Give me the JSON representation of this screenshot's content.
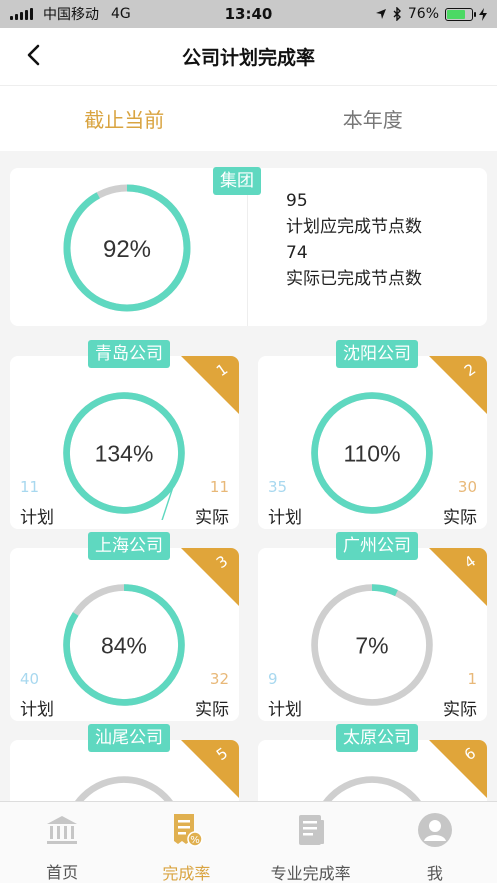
{
  "status_bar": {
    "carrier": "中国移动",
    "network": "4G",
    "time": "13:40",
    "battery": "76%",
    "battery_level": 0.76
  },
  "header": {
    "title": "公司计划完成率",
    "back_icon": "chevron-left-icon"
  },
  "segments": [
    {
      "label": "截止当前",
      "active": true
    },
    {
      "label": "本年度",
      "active": false
    }
  ],
  "group": {
    "tag": "集团",
    "percent": 92,
    "percent_label": "92%",
    "plan_value": "95",
    "plan_label": "计划应完成节点数",
    "actual_value": "74",
    "actual_label": "实际已完成节点数"
  },
  "companies": [
    {
      "name": "青岛公司",
      "rank": "1",
      "percent": 134,
      "percent_label": "134%",
      "plan": "11",
      "actual": "11",
      "plan_label": "计划",
      "actual_label": "实际"
    },
    {
      "name": "沈阳公司",
      "rank": "2",
      "percent": 110,
      "percent_label": "110%",
      "plan": "35",
      "actual": "30",
      "plan_label": "计划",
      "actual_label": "实际"
    },
    {
      "name": "上海公司",
      "rank": "3",
      "percent": 84,
      "percent_label": "84%",
      "plan": "40",
      "actual": "32",
      "plan_label": "计划",
      "actual_label": "实际"
    },
    {
      "name": "广州公司",
      "rank": "4",
      "percent": 7,
      "percent_label": "7%",
      "plan": "9",
      "actual": "1",
      "plan_label": "计划",
      "actual_label": "实际"
    },
    {
      "name": "汕尾公司",
      "rank": "5"
    },
    {
      "name": "太原公司",
      "rank": "6"
    }
  ],
  "tabbar": [
    {
      "label": "首页",
      "icon": "bank-icon",
      "active": false
    },
    {
      "label": "完成率",
      "icon": "receipt-percent-icon",
      "active": true
    },
    {
      "label": "专业完成率",
      "icon": "document-icon",
      "active": false
    },
    {
      "label": "我",
      "icon": "user-icon",
      "active": false
    }
  ],
  "colors": {
    "accent_gold": "#d9a441",
    "ring_teal": "#5fd8c0",
    "ring_gray": "#cfcfcf",
    "plan_blue": "#a8d8ef",
    "actual_orange": "#e8b878"
  }
}
